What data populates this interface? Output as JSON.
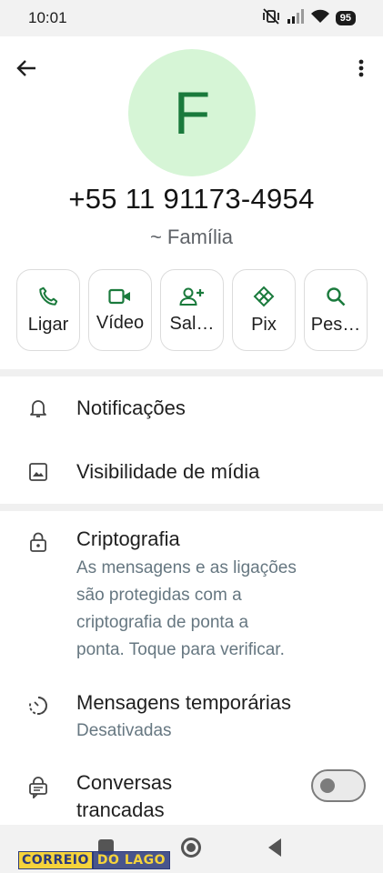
{
  "status_bar": {
    "time": "10:01",
    "battery": "95",
    "icons": [
      "mute-vibrate-icon",
      "signal-icon",
      "wifi-icon",
      "battery-icon"
    ]
  },
  "contact": {
    "avatar_letter": "F",
    "phone": "+55 11 91173-4954",
    "group": "~ Família"
  },
  "actions": [
    {
      "label": "Ligar",
      "icon": "phone-icon"
    },
    {
      "label": "Vídeo",
      "icon": "video-icon"
    },
    {
      "label": "Sal…",
      "icon": "add-contact-icon"
    },
    {
      "label": "Pix",
      "icon": "pix-icon"
    },
    {
      "label": "Pes…",
      "icon": "search-icon"
    }
  ],
  "settings": {
    "notifications": "Notificações",
    "media_visibility": "Visibilidade de mídia",
    "encryption_title": "Criptografia",
    "encryption_lines": [
      "As mensagens e as ligações",
      "são protegidas com a",
      "criptografia de ponta a",
      "ponta. Toque para verificar."
    ],
    "disappearing_title": "Mensagens temporárias",
    "disappearing_value": "Desativadas",
    "locked_title_lines": [
      "Conversas",
      "trancadas"
    ],
    "locked_enabled": false
  },
  "watermark": {
    "part1": "CORREIO",
    "part2": "DO LAGO"
  },
  "colors": {
    "accent": "#1a7a3c",
    "avatar_bg": "#d6f5d6",
    "secondary_text": "#667781"
  }
}
